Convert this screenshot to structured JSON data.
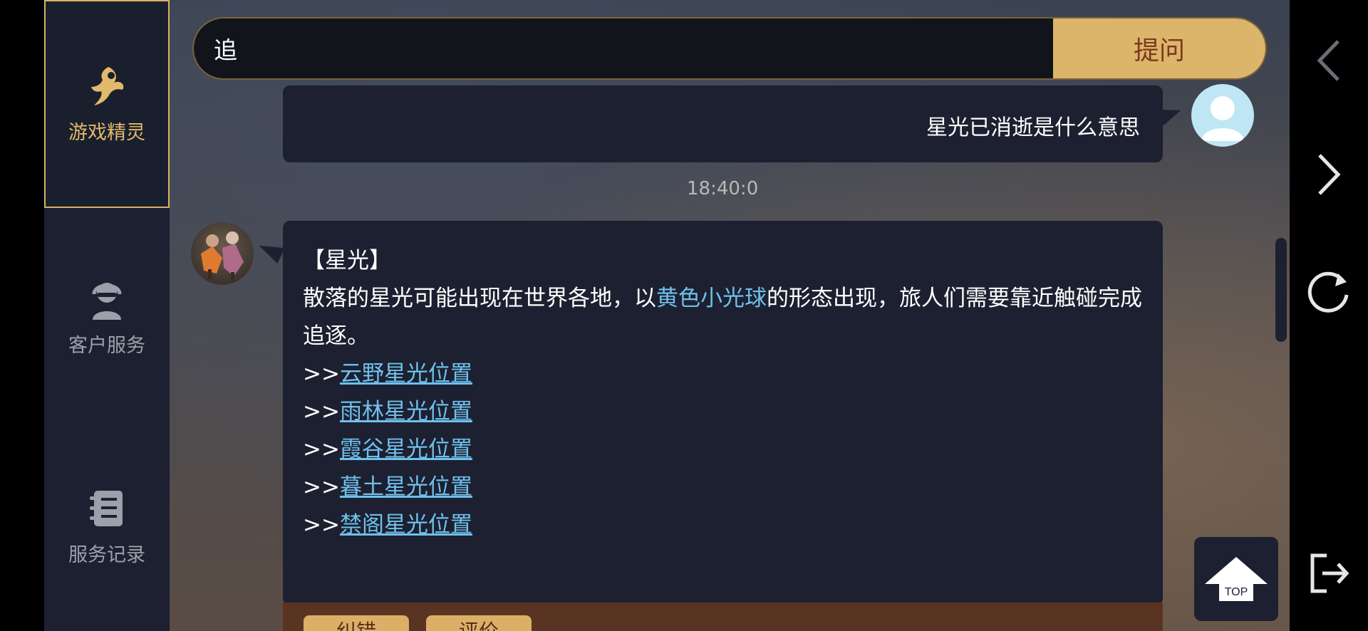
{
  "sidebar": {
    "items": [
      {
        "label": "游戏精灵",
        "icon": "fairy-icon"
      },
      {
        "label": "客户服务",
        "icon": "headset-agent-icon"
      },
      {
        "label": "服务记录",
        "icon": "notebook-icon"
      }
    ]
  },
  "search": {
    "value": "追",
    "button_label": "提问"
  },
  "chat": {
    "user_message": "星光已消逝是什么意思",
    "timestamp": "18:40:0",
    "reply": {
      "title": "【星光】",
      "text_before": "散落的星光可能出现在世界各地，以",
      "highlight": "黄色小光球",
      "text_after": "的形态出现，旅人们需要靠近触碰完成追逐。",
      "link_prefix": ">>",
      "links": [
        "云野星光位置",
        "雨林星光位置",
        "霞谷星光位置",
        "暮土星光位置",
        "禁阁星光位置"
      ]
    },
    "footer_buttons": [
      "纠错",
      "评价"
    ]
  },
  "top_button_label": "TOP",
  "colors": {
    "accent_gold": "#dcb46a",
    "panel_dark": "#1c2030",
    "link_blue": "#6fc0ec"
  }
}
